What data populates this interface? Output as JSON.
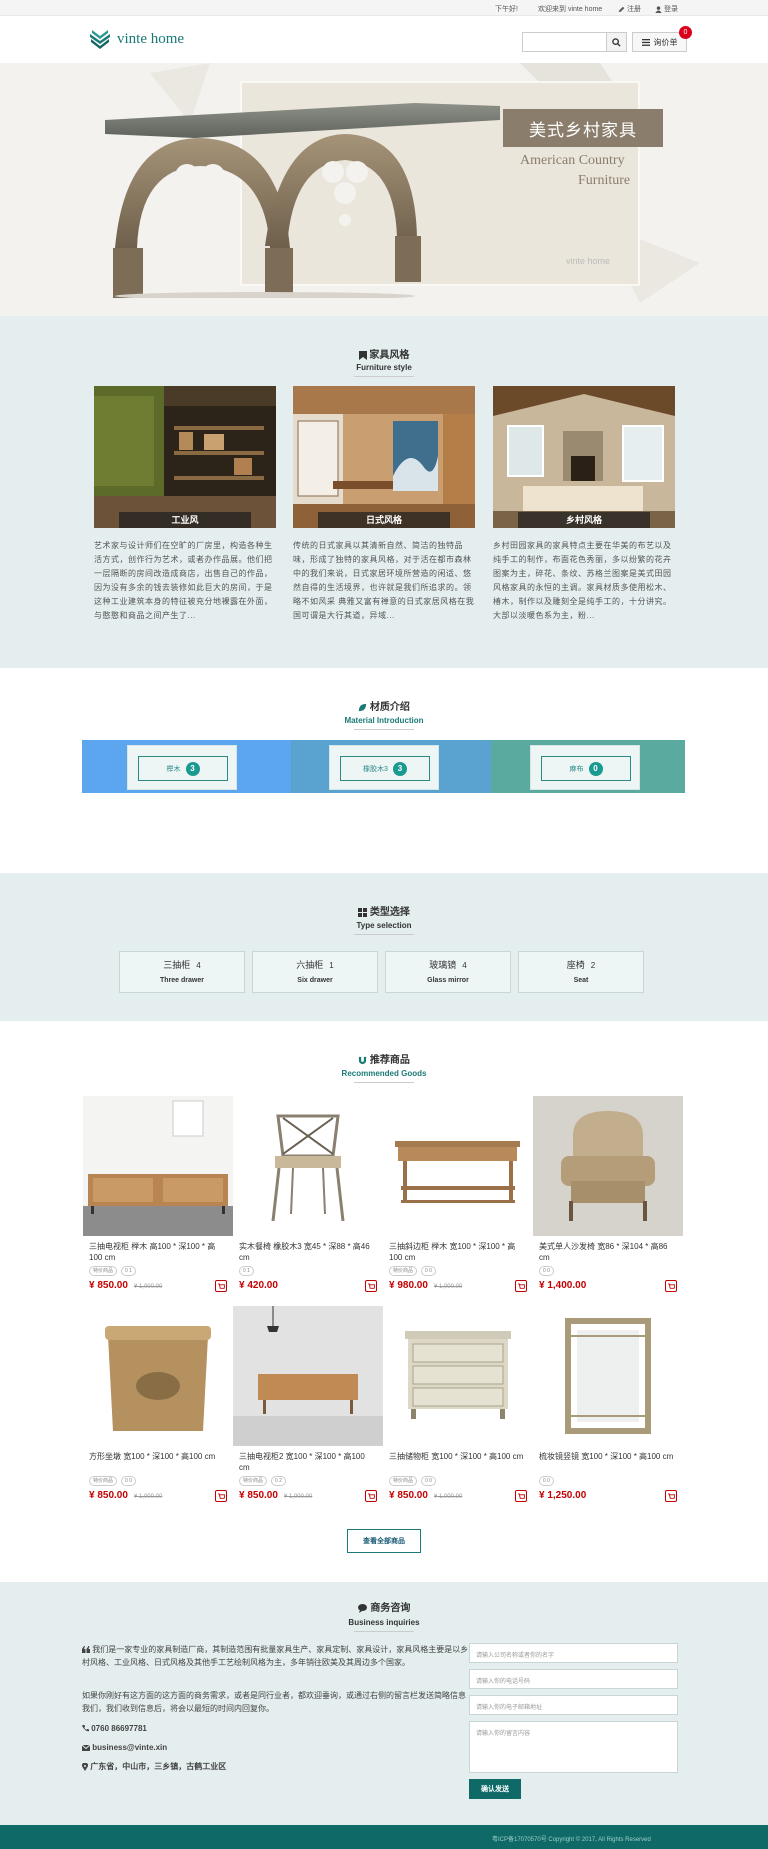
{
  "topbar": {
    "greeting": "下午好!",
    "welcome": "欢迎来到 vinte home",
    "register": "注册",
    "login": "登录"
  },
  "header": {
    "logo_text": "vinte home",
    "search_placeholder": "",
    "quote_label": "询价单",
    "quote_count": "0"
  },
  "banner": {
    "title_cn": "美式乡村家具",
    "title_en_line1": "American Country",
    "title_en_line2": "Furniture",
    "watermark": "vinte home"
  },
  "style_section": {
    "title": "家具风格",
    "subtitle": "Furniture style",
    "cards": [
      {
        "label": "工业风",
        "desc": "艺术家与设计师们在空旷的厂房里，构造各种生活方式，创作行为艺术，或者办作品展。他们把一层隔断的房间改造成商店，出售自己的作品，因为没有多余的钱去装修如此巨大的房间，于是这种工业建筑本身的特征被充分地裸露在外面，与憨憨和商品之间产生了..."
      },
      {
        "label": "日式风格",
        "desc": "传统的日式家具以其清新自然、简洁的独特品味，形成了独特的家具风格，对于活在都市森林中的我们来说，日式家居环境所营造的闲适、悠然自得的生活境界，也许就是我们所追求的。领略不如风采 典雅又富有禅意的日式家居风格在我国可谓是大行其道，异域..."
      },
      {
        "label": "乡村风格",
        "desc": "乡村田园家具的家具特点主要在华美的布艺以及纯手工的制作，布面花色秀丽，多以纷繁的花卉图案为主，碎花、条纹、苏格兰图案是美式田园风格家具的永恒的主调。家具材质多使用松木、椿木，制作以及雕刻全是纯手工的，十分讲究。大部以淡暖色系为主，粉..."
      }
    ]
  },
  "material_section": {
    "title": "材质介绍",
    "subtitle": "Material Introduction",
    "items": [
      {
        "label": "榉木",
        "count": "3",
        "band_color": "#5ba6ee"
      },
      {
        "label": "橡胶木3",
        "count": "3",
        "band_color": "#5aa2d0"
      },
      {
        "label": "麻布",
        "count": "0",
        "band_color": "#5aaaa0"
      }
    ]
  },
  "type_section": {
    "title": "类型选择",
    "subtitle": "Type selection",
    "items": [
      {
        "name": "三抽柜",
        "count": "4",
        "en": "Three drawer"
      },
      {
        "name": "六抽柜",
        "count": "1",
        "en": "Six drawer"
      },
      {
        "name": "玻璃镜",
        "count": "4",
        "en": "Glass mirror"
      },
      {
        "name": "座椅",
        "count": "2",
        "en": "Seat"
      }
    ]
  },
  "recommend_section": {
    "title": "推荐商品",
    "subtitle": "Recommended Goods",
    "view_all": "查看全部商品",
    "products": [
      {
        "name": "三抽电视柜 榉木 高100 * 深100 * 高100 cm",
        "tags": [
          "特价商品",
          "0 1"
        ],
        "price": "¥ 850.00",
        "old": "¥ 1,000.00"
      },
      {
        "name": "实木餐椅 橡胶木3 宽45 * 深88 * 高46 cm",
        "tags": [
          "0 1"
        ],
        "price": "¥ 420.00",
        "old": ""
      },
      {
        "name": "三抽斜边柜 榉木 宽100 * 深100 * 高100 cm",
        "tags": [
          "特价商品",
          "0 0"
        ],
        "price": "¥ 980.00",
        "old": "¥ 1,000.00"
      },
      {
        "name": "美式单人沙发椅 宽86 * 深104 * 高86 cm",
        "tags": [
          "0 0"
        ],
        "price": "¥ 1,400.00",
        "old": ""
      },
      {
        "name": "方形坐墩 宽100 * 深100 * 高100 cm",
        "tags": [
          "特价商品",
          "0 0"
        ],
        "price": "¥ 850.00",
        "old": "¥ 1,000.00"
      },
      {
        "name": "三抽电视柜2 宽100 * 深100 * 高100 cm",
        "tags": [
          "特价商品",
          "0 2"
        ],
        "price": "¥ 850.00",
        "old": "¥ 1,000.00"
      },
      {
        "name": "三抽储物柜 宽100 * 深100 * 高100 cm",
        "tags": [
          "特价商品",
          "0 0"
        ],
        "price": "¥ 850.00",
        "old": "¥ 1,000.00"
      },
      {
        "name": "梳妆镜竖镜 宽100 * 深100 * 高100 cm",
        "tags": [
          "0 0"
        ],
        "price": "¥ 1,250.00",
        "old": ""
      }
    ]
  },
  "business_section": {
    "title": "商务咨询",
    "subtitle": "Business inquiries",
    "intro": "我们是一家专业的家具制造厂商，其制造范围有批量家具生产、家具定制、家具设计，家具风格主要是以乡村风格、工业风格、日式风格及其他手工艺绘制风格为主，多年销往欧美及其周边多个国家。",
    "intro2": "如果你刚好有这方面的这方面的商务需求，或者是同行业者，都欢迎垂询，或通过右侧的留言栏发送简略信息我们，我们收到信息后，将会以最短的时间内回复你。",
    "phone": "0760 86697781",
    "email": "business@vinte.xin",
    "address": "广东省，中山市，三乡镇，古鹤工业区",
    "fields": {
      "name": "请输入公司名称或者你的名字",
      "phone": "请输入你的电话号码",
      "email": "请输入你的电子邮箱地址",
      "message": "请输入你的留言内容"
    },
    "send": "确认发送"
  },
  "footer": {
    "text": "粤ICP备17070570号 Copyright © 2017, All Rights Reserved"
  },
  "colors": {
    "brand": "#1a7a76",
    "footer": "#0f6a67",
    "price": "#c40000",
    "section_bg": "#e4eeee"
  }
}
